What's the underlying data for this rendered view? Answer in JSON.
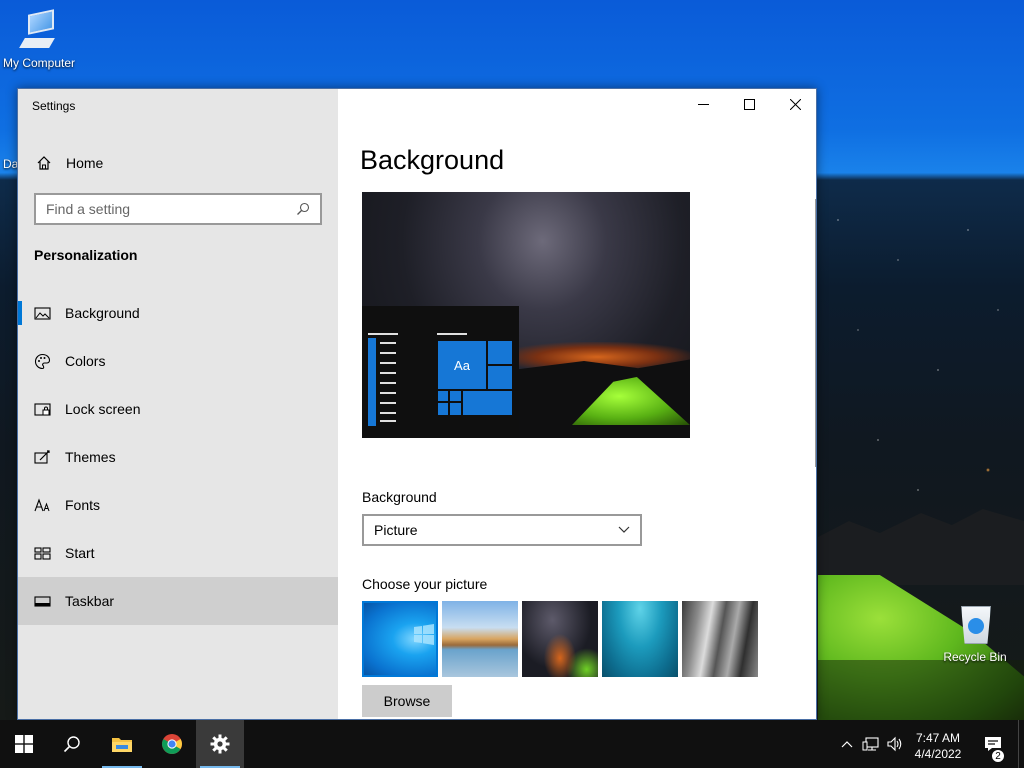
{
  "desktop": {
    "icons": [
      {
        "label": "My Computer"
      },
      {
        "label": "Recycle Bin"
      }
    ],
    "stray_text": "Da"
  },
  "window": {
    "title": "Settings",
    "controls": {
      "minimize": "minimize-icon",
      "maximize": "maximize-icon",
      "close": "close-icon"
    }
  },
  "sidebar": {
    "home_label": "Home",
    "search_placeholder": "Find a setting",
    "section_title": "Personalization",
    "items": [
      {
        "label": "Background",
        "icon": "picture-icon",
        "active": true
      },
      {
        "label": "Colors",
        "icon": "palette-icon"
      },
      {
        "label": "Lock screen",
        "icon": "lock-screen-icon"
      },
      {
        "label": "Themes",
        "icon": "themes-icon"
      },
      {
        "label": "Fonts",
        "icon": "fonts-icon"
      },
      {
        "label": "Start",
        "icon": "start-icon"
      },
      {
        "label": "Taskbar",
        "icon": "taskbar-icon",
        "hover": true
      }
    ]
  },
  "main": {
    "title": "Background",
    "preview": {
      "tile_text": "Aa"
    },
    "background_label": "Background",
    "background_value": "Picture",
    "choose_label": "Choose your picture",
    "browse_label": "Browse",
    "thumbnails": [
      {
        "name": "windows-blue",
        "selected": true
      },
      {
        "name": "beach-rocks"
      },
      {
        "name": "night-sky-tent"
      },
      {
        "name": "underwater-swimmer"
      },
      {
        "name": "rock-wall"
      }
    ]
  },
  "taskbar": {
    "items": [
      "start-icon",
      "search-icon",
      "file-explorer-icon",
      "chrome-icon",
      "settings-icon"
    ],
    "time": "7:47 AM",
    "date": "4/4/2022",
    "notification_count": "2"
  },
  "colors": {
    "accent": "#0078d7",
    "sidebar_bg": "#e6e6e6",
    "taskbar_bg": "#101010"
  }
}
